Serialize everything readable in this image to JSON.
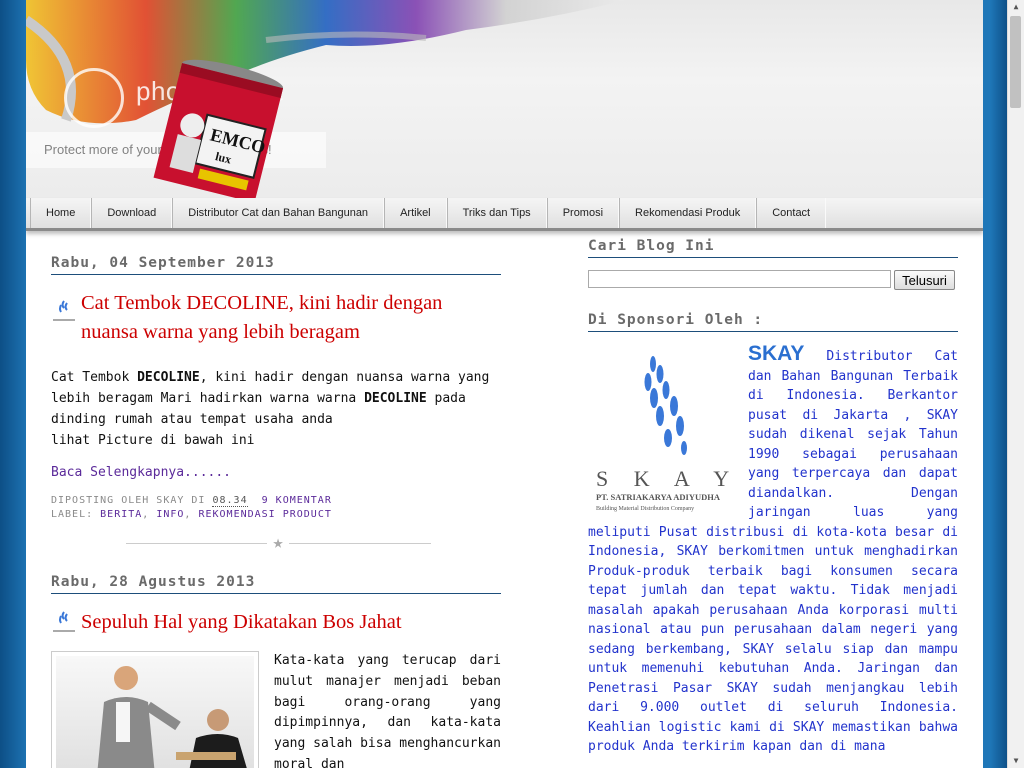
{
  "header": {
    "watermark_text": "photobucket",
    "protect_text": "Protect more of your memories for less!",
    "can_brand": "EMCO",
    "can_sub": "lux"
  },
  "nav": {
    "items": [
      "Home",
      "Download",
      "Distributor Cat dan Bahan Bangunan",
      "Artikel",
      "Triks dan Tips",
      "Promosi",
      "Rekomendasi Produk",
      "Contact"
    ]
  },
  "posts": [
    {
      "date": "Rabu, 04 September 2013",
      "title": "Cat Tembok DECOLINE, kini hadir dengan nuansa warna yang lebih beragam",
      "body_line1_pre": "Cat Tembok ",
      "body_line1_bold": "DECOLINE",
      "body_line1_post": ", kini hadir dengan nuansa warna yang lebih beragam Mari hadirkan warna warna ",
      "body_line2_bold": "DECOLINE",
      "body_line2_post": " pada dinding rumah atau tempat usaha anda",
      "body_line3": "lihat Picture di bawah ini",
      "read_more": "Baca Selengkapnya......",
      "posted_by_label": "DIPOSTING OLEH SKAY DI",
      "time": "08.34",
      "comments": "9 KOMENTAR",
      "labels_prefix": "LABEL:",
      "labels": [
        "BERITA",
        "INFO",
        "REKOMENDASI PRODUCT"
      ]
    },
    {
      "date": "Rabu, 28 Agustus 2013",
      "title": "Sepuluh Hal yang Dikatakan Bos Jahat",
      "body": "Kata-kata yang terucap dari mulut manajer menjadi beban bagi orang-orang yang dipimpinnya, dan kata-kata yang salah bisa menghancurkan moral dan"
    }
  ],
  "sidebar": {
    "search_title": "Cari Blog Ini",
    "search_button": "Telusuri",
    "search_value": "",
    "sponsor_title": "Di Sponsori Oleh :",
    "sponsor_logo_name": "S K A Y",
    "sponsor_logo_company": "PT. SATRIAKARYA ADIYUDHA",
    "sponsor_logo_tagline": "Building Material Distribution Company",
    "sponsor_big": "SKAY",
    "sponsor_text": " Distributor Cat dan Bahan Bangunan Terbaik di Indonesia. Berkantor pusat di Jakarta , SKAY sudah dikenal sejak Tahun 1990 sebagai perusahaan yang terpercaya dan dapat diandalkan. Dengan jaringan luas yang meliputi Pusat distribusi di kota-kota besar di Indonesia, SKAY berkomitmen untuk menghadirkan Produk-produk terbaik bagi konsumen secara tepat jumlah dan tepat waktu. Tidak menjadi masalah apakah perusahaan Anda korporasi multi nasional atau pun perusahaan dalam negeri yang sedang berkembang, SKAY selalu siap dan mampu untuk memenuhi kebutuhan Anda. Jaringan dan Penetrasi Pasar SKAY sudah menjangkau lebih dari 9.000 outlet di seluruh Indonesia. Keahlian logistic kami di SKAY memastikan bahwa produk Anda terkirim kapan dan di mana"
  },
  "colors": {
    "title_red": "#cc0000",
    "link_purple": "#5b2a9a",
    "sponsor_blue": "#2233cc",
    "bg_blue": "#1f77b8"
  }
}
